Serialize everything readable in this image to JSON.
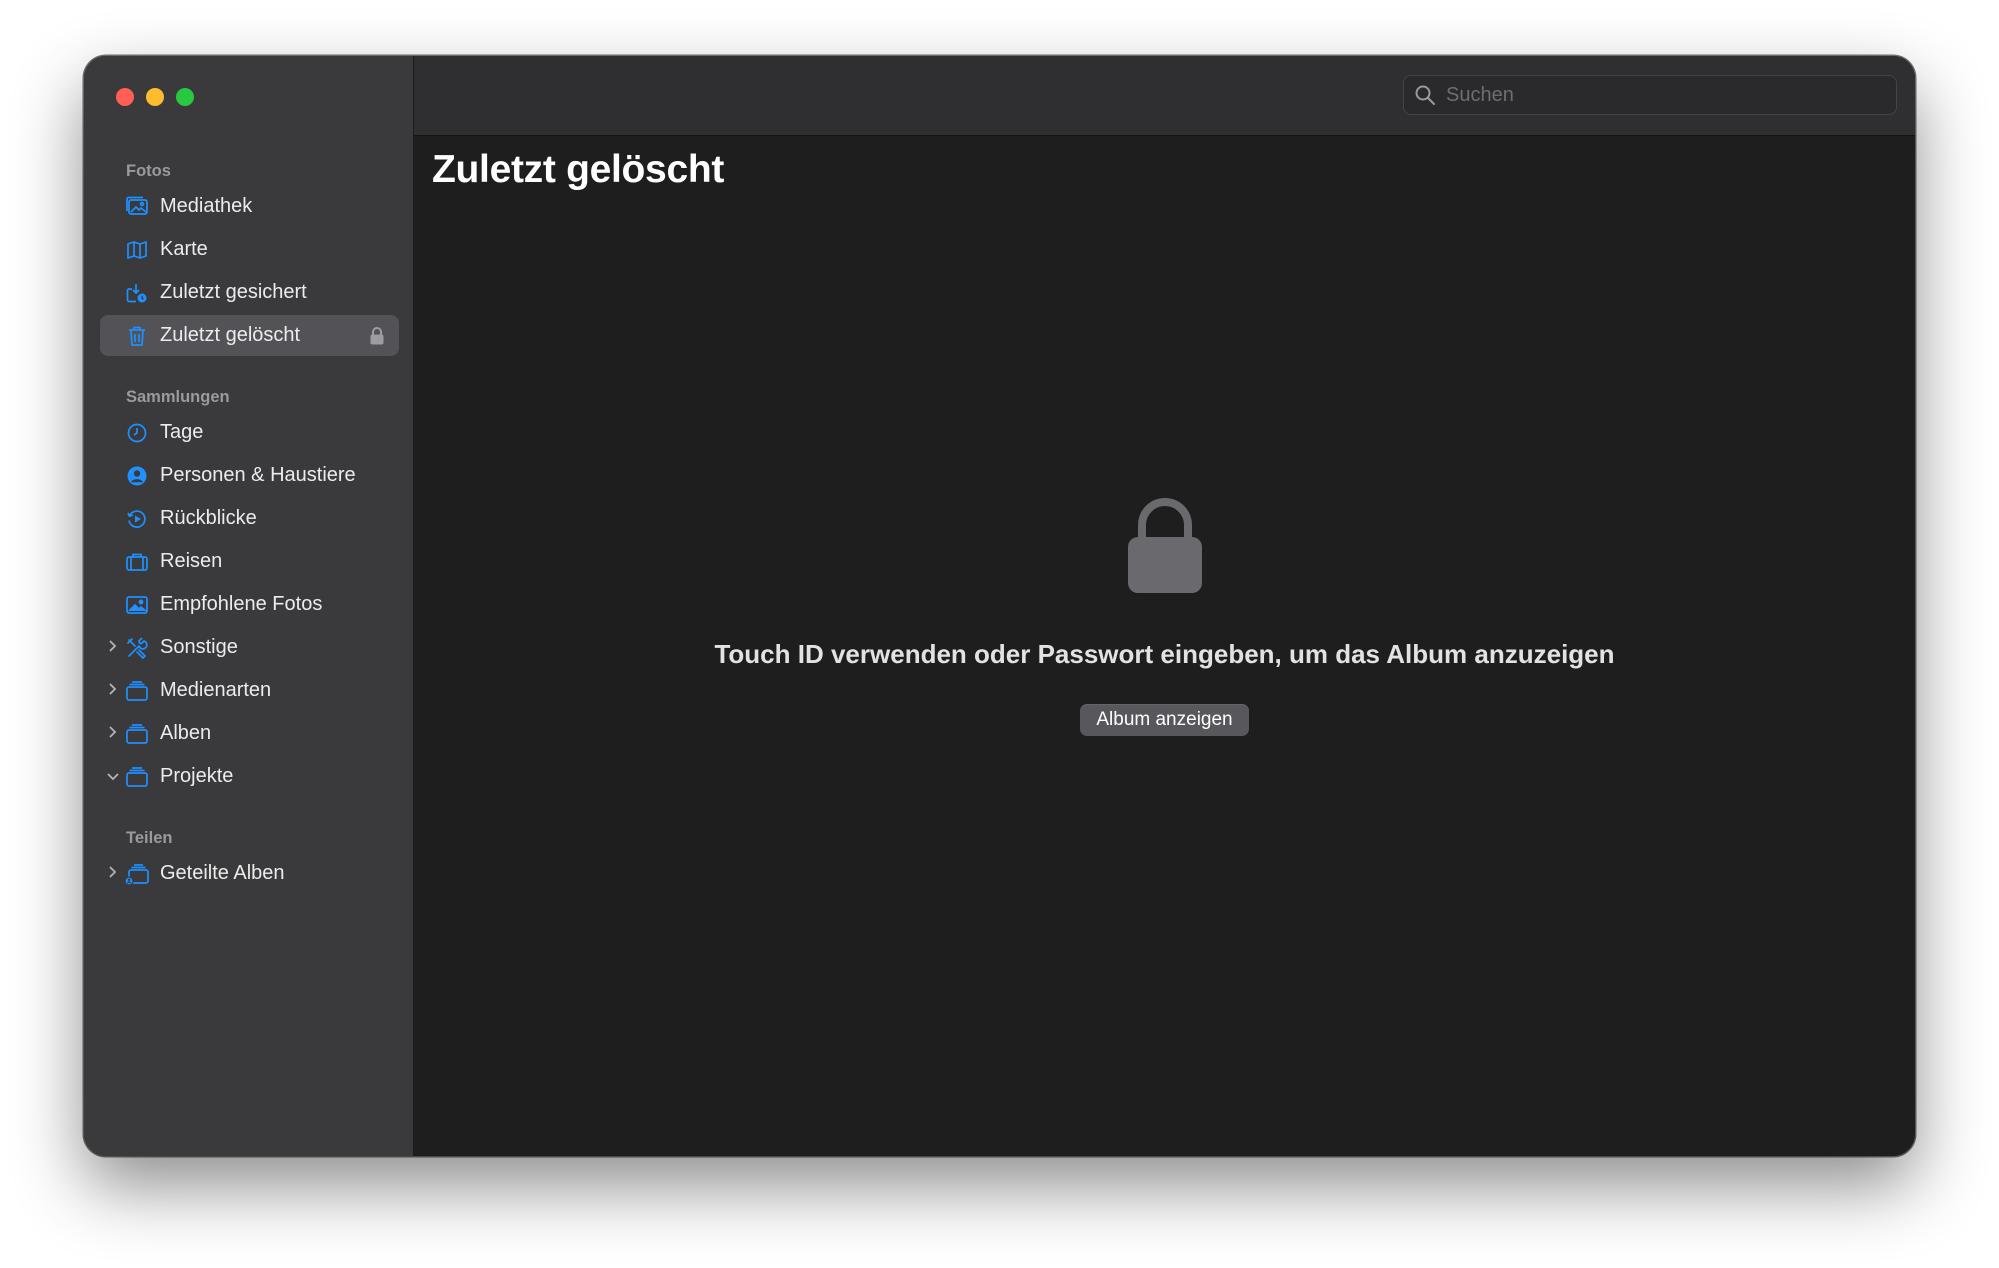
{
  "sidebar": {
    "sections": {
      "fotos": {
        "title": "Fotos",
        "items": [
          {
            "label": "Mediathek",
            "icon": "photo-library-icon"
          },
          {
            "label": "Karte",
            "icon": "map-icon"
          },
          {
            "label": "Zuletzt gesichert",
            "icon": "recently-saved-icon"
          },
          {
            "label": "Zuletzt gelöscht",
            "icon": "trash-icon",
            "selected": true,
            "locked": true
          }
        ]
      },
      "sammlungen": {
        "title": "Sammlungen",
        "items": [
          {
            "label": "Tage",
            "icon": "clock-icon"
          },
          {
            "label": "Personen & Haustiere",
            "icon": "person-icon"
          },
          {
            "label": "Rückblicke",
            "icon": "memories-icon"
          },
          {
            "label": "Reisen",
            "icon": "suitcase-icon"
          },
          {
            "label": "Empfohlene Fotos",
            "icon": "featured-photo-icon"
          },
          {
            "label": "Sonstige",
            "icon": "tools-icon",
            "expanded": false
          },
          {
            "label": "Medienarten",
            "icon": "folder-stack-icon",
            "expanded": false
          },
          {
            "label": "Alben",
            "icon": "folder-stack-icon",
            "expanded": false
          },
          {
            "label": "Projekte",
            "icon": "folder-stack-icon",
            "expanded": true
          }
        ]
      },
      "teilen": {
        "title": "Teilen",
        "items": [
          {
            "label": "Geteilte Alben",
            "icon": "shared-albums-icon",
            "expanded": false
          }
        ]
      }
    }
  },
  "toolbar": {
    "search_placeholder": "Suchen"
  },
  "main": {
    "title": "Zuletzt gelöscht",
    "locked_message": "Touch ID verwenden oder Passwort eingeben, um das Album anzuzeigen",
    "show_button_label": "Album anzeigen"
  },
  "colors": {
    "accent_icon": "#1e90ff",
    "sidebar_bg": "#3a3a3c",
    "content_bg": "#1e1e1e",
    "selected_bg": "#535357"
  }
}
